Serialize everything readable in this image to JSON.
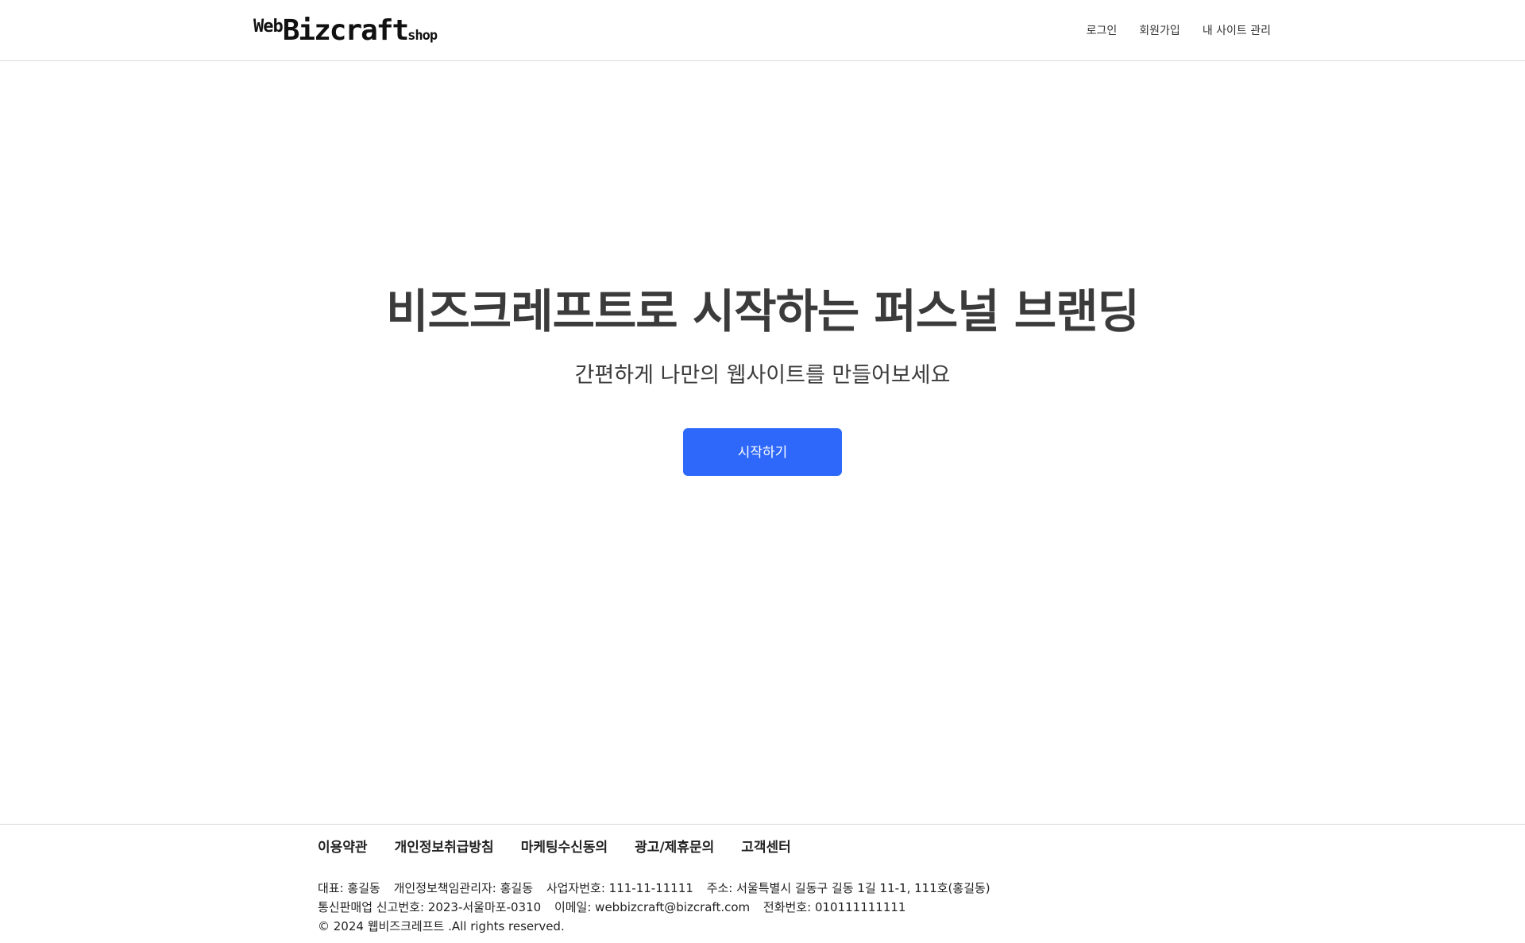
{
  "header": {
    "logo": {
      "web": "Web",
      "biz": "Bizcraft",
      "shop": "shop"
    },
    "nav": [
      {
        "label": "로그인"
      },
      {
        "label": "회원가입"
      },
      {
        "label": "내 사이트 관리"
      }
    ]
  },
  "hero": {
    "title": "비즈크레프트로 시작하는 퍼스널 브랜딩",
    "subtitle": "간편하게 나만의 웹사이트를 만들어보세요",
    "cta_label": "시작하기",
    "cta_color": "#2d68fa"
  },
  "footer": {
    "links": [
      {
        "label": "이용약관"
      },
      {
        "label": "개인정보취급방침"
      },
      {
        "label": "마케팅수신동의"
      },
      {
        "label": "광고/제휴문의"
      },
      {
        "label": "고객센터"
      }
    ],
    "info": {
      "ceo": "대표: 홍길동",
      "privacy_officer": "개인정보책임관리자: 홍길동",
      "business_no": "사업자번호: 111-11-11111",
      "address": "주소: 서울특별시 길동구 길동 1길 11-1, 111호(홍길동)",
      "ecommerce_no": "통신판매업 신고번호: 2023-서울마포-0310",
      "email": "이메일: webbizcraft@bizcraft.com",
      "phone": "전화번호: 010111111111",
      "copyright": "© 2024 웹비즈크레프트 .All rights reserved."
    }
  }
}
